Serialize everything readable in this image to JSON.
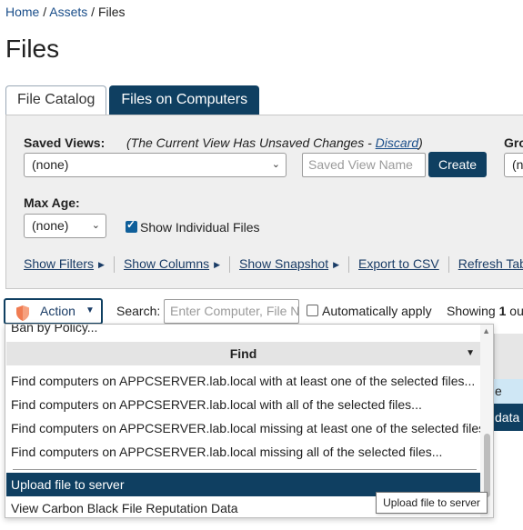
{
  "breadcrumb": {
    "home": "Home",
    "sep1": " / ",
    "assets": "Assets",
    "sep2": " / ",
    "current": "Files"
  },
  "page_title": "Files",
  "tabs": [
    {
      "label": "File Catalog",
      "active": false
    },
    {
      "label": "Files on Computers",
      "active": true
    }
  ],
  "filters": {
    "saved_views_label": "Saved Views:",
    "unsaved_prefix": "(The Current View Has Unsaved Changes - ",
    "discard_link": "Discard",
    "unsaved_suffix": ")",
    "saved_view_value": "(none)",
    "saved_view_name_placeholder": "Saved View Name",
    "create_button": "Create",
    "group_label_partial": "Gro",
    "group_value_partial": "(n",
    "max_age_label": "Max Age:",
    "max_age_value": "(none)",
    "show_individual_files_label": "Show Individual Files",
    "show_individual_files_checked": true
  },
  "panel_links": [
    "Show Filters",
    "Show Columns",
    "Show Snapshot",
    "Export to CSV",
    "Refresh Tab"
  ],
  "toolbar": {
    "action_label": "Action",
    "search_label": "Search:",
    "search_placeholder": "Enter Computer, File Name",
    "auto_apply_label": "Automatically apply",
    "showing_prefix": "Showing ",
    "showing_count": "1",
    "showing_suffix": " ou"
  },
  "background_table": {
    "cell_1": "e",
    "cell_2": "data"
  },
  "action_menu": {
    "partial_item": "Ban by Policy...",
    "find_header": "Find",
    "find_items": [
      "Find computers on APPCSERVER.lab.local with at least one of the selected files...",
      "Find computers on APPCSERVER.lab.local with all of the selected files...",
      "Find computers on APPCSERVER.lab.local missing at least one of the selected files...",
      "Find computers on APPCSERVER.lab.local missing all of the selected files..."
    ],
    "upload_item": "Upload file to server",
    "reputation_item": "View Carbon Black File Reputation Data"
  },
  "tooltip": "Upload file to server",
  "colors": {
    "primary": "#0f3f61",
    "link": "#1a4e8a",
    "shield": "#f07c52"
  }
}
